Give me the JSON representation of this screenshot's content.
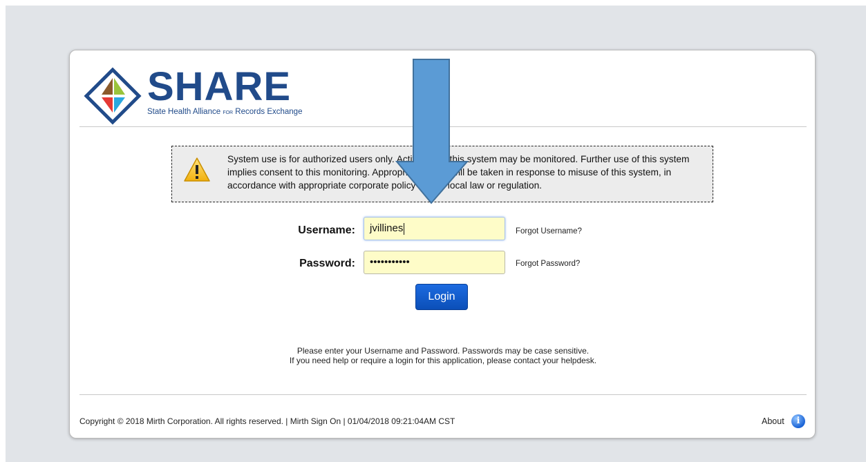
{
  "logo": {
    "word": "SHARE",
    "tagline_part1": "State Health Alliance ",
    "tagline_for": "FOR",
    "tagline_part2": " Records Exchange"
  },
  "warning": {
    "text": "System use is for authorized users only. Activities on this system may be monitored. Further use of this system implies consent to this monitoring. Appropriate action will be taken in response to misuse of this system, in accordance with appropriate corporate policy and/or local law or regulation.",
    "icon": "warning-triangle-icon"
  },
  "form": {
    "username_label": "Username:",
    "username_value": "jvillines",
    "password_label": "Password:",
    "password_value": "•••••••••••",
    "forgot_username": "Forgot Username?",
    "forgot_password": "Forgot Password?",
    "login_label": "Login"
  },
  "help": {
    "line1": "Please enter your Username and Password. Passwords may be case sensitive.",
    "line2": "If you need help or require a login for this application, please contact your helpdesk."
  },
  "footer": {
    "text": "Copyright © 2018 Mirth Corporation. All rights reserved. | Mirth Sign On | 01/04/2018 09:21:04AM CST",
    "about_label": "About",
    "about_icon": "info-icon"
  },
  "colors": {
    "brand_blue": "#214b8a",
    "input_bg": "#fefcc8",
    "button_blue": "#0b4fb8",
    "arrow_blue": "#5b9bd5"
  }
}
